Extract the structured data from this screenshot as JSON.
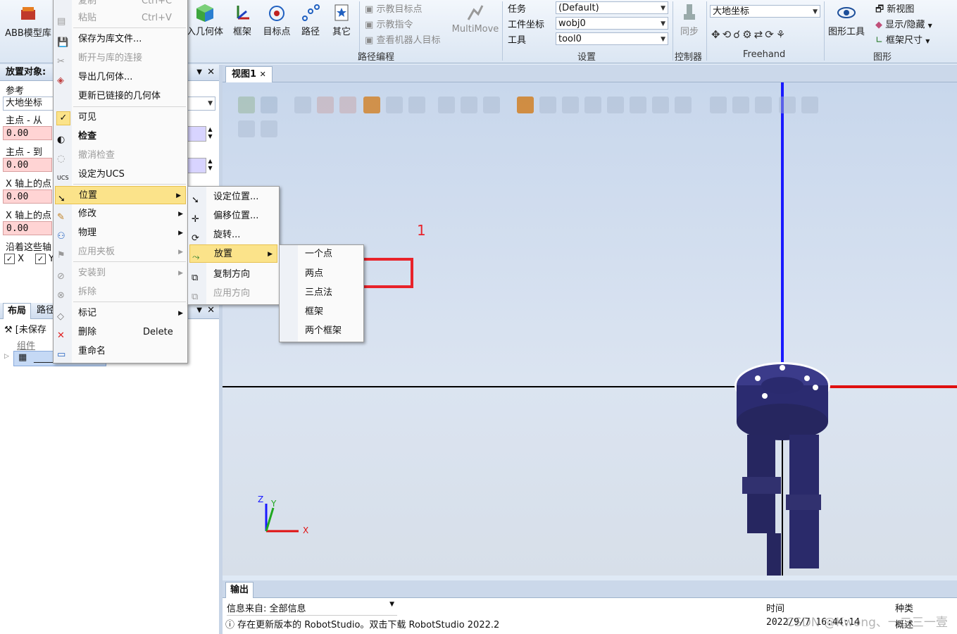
{
  "ribbon": {
    "abb_library": "ABB模型库",
    "import_geometry": "入几何体",
    "frame": "框架",
    "target": "目标点",
    "path": "路径",
    "other": "其它",
    "teach_target": "示教目标点",
    "teach_instruction": "示教指令",
    "view_robot_target": "查看机器人目标",
    "multimove": "MultiMove",
    "path_programming_group": "路径编程",
    "task_label": "任务",
    "task_value": "(Default)",
    "workobj_label": "工件坐标",
    "workobj_value": "wobj0",
    "tool_label": "工具",
    "tool_value": "tool0",
    "settings_group": "设置",
    "sync": "同步",
    "controller_group": "控制器",
    "frame_select": "大地坐标",
    "freehand_group": "Freehand",
    "graphics_tools": "图形工具",
    "new_view": "新视图",
    "show_hide": "显示/隐藏",
    "frame_size": "框架尺寸",
    "graphics_group": "图形"
  },
  "left_panel": {
    "title": "放置对象:",
    "ref_label": "参考",
    "ref_value": "大地坐标",
    "main_point_from": "主点 - 从",
    "main_point_to": "主点 - 到",
    "x_axis_point": "X 轴上的点",
    "x_axis_point2": "X 轴上的点",
    "value": "0.00",
    "along_axes": "沿着这些轴",
    "axis_x": "X",
    "axis_y": "Y"
  },
  "layout_panel": {
    "tab_layout": "布局",
    "tab_path": "路径",
    "station": "[未保存",
    "components": "组件",
    "item": "___________"
  },
  "context_menu": {
    "copy": "复制",
    "copy_shortcut": "Ctrl+C",
    "paste": "粘贴",
    "paste_shortcut": "Ctrl+V",
    "save_as_library": "保存为库文件...",
    "disconnect_library": "断开与库的连接",
    "export_geometry": "导出几何体...",
    "update_linked": "更新已链接的几何体",
    "visible": "可见",
    "inspect": "检查",
    "cancel_inspect": "撤消检查",
    "set_ucs": "设定为UCS",
    "position": "位置",
    "modify": "修改",
    "physics": "物理",
    "apply_clamp": "应用夹板",
    "install_to": "安装到",
    "remove": "拆除",
    "mark": "标记",
    "delete": "删除",
    "delete_shortcut": "Delete",
    "rename": "重命名"
  },
  "position_submenu": {
    "set_position": "设定位置...",
    "offset_position": "偏移位置...",
    "rotate": "旋转...",
    "place": "放置",
    "copy_orientation": "复制方向",
    "apply_orientation": "应用方向"
  },
  "place_submenu": {
    "one_point": "一个点",
    "two_points": "两点",
    "three_points": "三点法",
    "frame": "框架",
    "two_frames": "两个框架"
  },
  "view": {
    "tab": "视图1",
    "annotation": "1",
    "axis_z": "Z",
    "axis_y": "Y",
    "axis_x": "X"
  },
  "output": {
    "tab": "输出",
    "source_label": "信息来自: 全部信息",
    "time_header": "时间",
    "type_header": "种类",
    "message": "存在更新版本的 RobotStudio。双击下载 RobotStudio 2022.2",
    "time": "2022/9/7 16:44:14",
    "type": "概述",
    "watermark": "CSDN @Kwong、一二三一壹"
  },
  "colors": {
    "highlight": "#fbe38a",
    "annotation_red": "#e8222a",
    "axis_blue": "#1a1aff",
    "axis_red": "#e01010",
    "gripper": "#2e2e7a"
  }
}
